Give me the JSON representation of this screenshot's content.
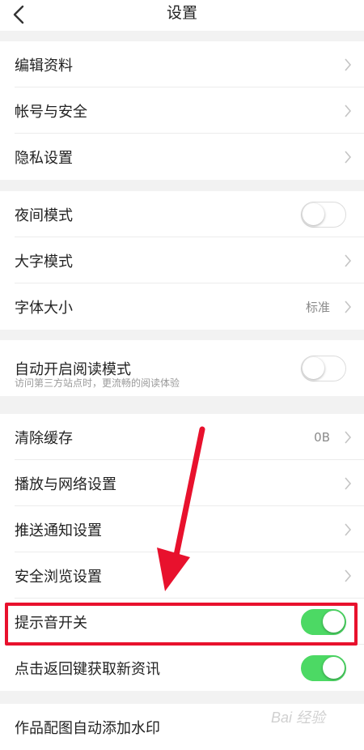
{
  "header": {
    "title": "设置"
  },
  "groups": [
    {
      "items": [
        {
          "label": "编辑资料"
        },
        {
          "label": "帐号与安全"
        },
        {
          "label": "隐私设置"
        }
      ]
    },
    {
      "items": [
        {
          "label": "夜间模式",
          "toggle": false
        },
        {
          "label": "大字模式"
        },
        {
          "label": "字体大小",
          "value": "标准"
        }
      ]
    },
    {
      "items": [
        {
          "label": "自动开启阅读模式",
          "sublabel": "访问第三方站点时，更流畅的阅读体验",
          "toggle": false
        }
      ]
    },
    {
      "items": [
        {
          "label": "清除缓存",
          "value": "0B"
        },
        {
          "label": "播放与网络设置"
        },
        {
          "label": "推送通知设置"
        },
        {
          "label": "安全浏览设置"
        },
        {
          "label": "提示音开关",
          "toggle": true
        },
        {
          "label": "点击返回键获取新资讯",
          "toggle": true
        }
      ]
    },
    {
      "items": [
        {
          "label": "作品配图自动添加水印"
        }
      ]
    }
  ],
  "colors": {
    "toggle_on": "#4cd964",
    "highlight": "#e8112d"
  },
  "watermark": "Bai 经验"
}
